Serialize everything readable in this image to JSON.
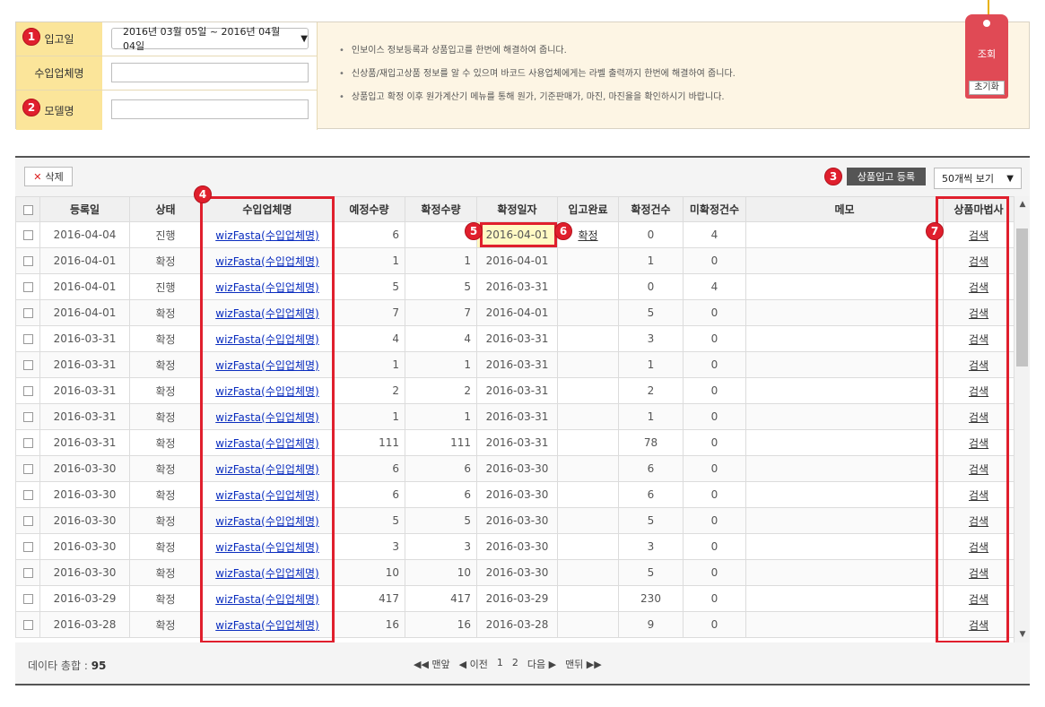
{
  "search": {
    "date_label": "입고일",
    "date_range": "2016년 03월 05일 ~ 2016년 04월 04일",
    "vendor_label": "수입업체명",
    "vendor_value": "",
    "model_label": "모델명",
    "model_value": "",
    "info": [
      "인보이스 정보등록과 상품입고를 한번에 해결하여 줍니다.",
      "신상품/재입고상품 정보를 알 수 있으며 바코드 사용업체에게는 라벨 출력까지 한번에 해결하여 줍니다.",
      "상품입고 확정 이후 원가계산기 메뉴를 통해 원가, 기준판매가, 마진, 마진율을 확인하시기 바랍니다."
    ],
    "search_button": "조회",
    "reset_button": "초기화"
  },
  "toolbar": {
    "delete_label": "삭제",
    "register_label": "상품입고 등록",
    "page_size": "50개씩 보기"
  },
  "badges": [
    "1",
    "2",
    "3",
    "4",
    "5",
    "6",
    "7"
  ],
  "table": {
    "headers": [
      "등록일",
      "상태",
      "수입업체명",
      "예정수량",
      "확정수량",
      "확정일자",
      "입고완료",
      "확정건수",
      "미확정건수",
      "메모",
      "상품마법사"
    ],
    "rows": [
      {
        "date": "2016-04-04",
        "status": "진행",
        "vendor": "wizFasta(수입업체명)",
        "planned": "6",
        "confirmed": "",
        "confirm_date": "2016-04-01",
        "done": "확정",
        "cnt_ok": "0",
        "cnt_pending": "4",
        "memo": "",
        "wizard": "검색"
      },
      {
        "date": "2016-04-01",
        "status": "확정",
        "vendor": "wizFasta(수입업체명)",
        "planned": "1",
        "confirmed": "1",
        "confirm_date": "2016-04-01",
        "done": "",
        "cnt_ok": "1",
        "cnt_pending": "0",
        "memo": "",
        "wizard": "검색"
      },
      {
        "date": "2016-04-01",
        "status": "진행",
        "vendor": "wizFasta(수입업체명)",
        "planned": "5",
        "confirmed": "5",
        "confirm_date": "2016-03-31",
        "done": "",
        "cnt_ok": "0",
        "cnt_pending": "4",
        "memo": "",
        "wizard": "검색"
      },
      {
        "date": "2016-04-01",
        "status": "확정",
        "vendor": "wizFasta(수입업체명)",
        "planned": "7",
        "confirmed": "7",
        "confirm_date": "2016-04-01",
        "done": "",
        "cnt_ok": "5",
        "cnt_pending": "0",
        "memo": "",
        "wizard": "검색"
      },
      {
        "date": "2016-03-31",
        "status": "확정",
        "vendor": "wizFasta(수입업체명)",
        "planned": "4",
        "confirmed": "4",
        "confirm_date": "2016-03-31",
        "done": "",
        "cnt_ok": "3",
        "cnt_pending": "0",
        "memo": "",
        "wizard": "검색"
      },
      {
        "date": "2016-03-31",
        "status": "확정",
        "vendor": "wizFasta(수입업체명)",
        "planned": "1",
        "confirmed": "1",
        "confirm_date": "2016-03-31",
        "done": "",
        "cnt_ok": "1",
        "cnt_pending": "0",
        "memo": "",
        "wizard": "검색"
      },
      {
        "date": "2016-03-31",
        "status": "확정",
        "vendor": "wizFasta(수입업체명)",
        "planned": "2",
        "confirmed": "2",
        "confirm_date": "2016-03-31",
        "done": "",
        "cnt_ok": "2",
        "cnt_pending": "0",
        "memo": "",
        "wizard": "검색"
      },
      {
        "date": "2016-03-31",
        "status": "확정",
        "vendor": "wizFasta(수입업체명)",
        "planned": "1",
        "confirmed": "1",
        "confirm_date": "2016-03-31",
        "done": "",
        "cnt_ok": "1",
        "cnt_pending": "0",
        "memo": "",
        "wizard": "검색"
      },
      {
        "date": "2016-03-31",
        "status": "확정",
        "vendor": "wizFasta(수입업체명)",
        "planned": "111",
        "confirmed": "111",
        "confirm_date": "2016-03-31",
        "done": "",
        "cnt_ok": "78",
        "cnt_pending": "0",
        "memo": "",
        "wizard": "검색"
      },
      {
        "date": "2016-03-30",
        "status": "확정",
        "vendor": "wizFasta(수입업체명)",
        "planned": "6",
        "confirmed": "6",
        "confirm_date": "2016-03-30",
        "done": "",
        "cnt_ok": "6",
        "cnt_pending": "0",
        "memo": "",
        "wizard": "검색"
      },
      {
        "date": "2016-03-30",
        "status": "확정",
        "vendor": "wizFasta(수입업체명)",
        "planned": "6",
        "confirmed": "6",
        "confirm_date": "2016-03-30",
        "done": "",
        "cnt_ok": "6",
        "cnt_pending": "0",
        "memo": "",
        "wizard": "검색"
      },
      {
        "date": "2016-03-30",
        "status": "확정",
        "vendor": "wizFasta(수입업체명)",
        "planned": "5",
        "confirmed": "5",
        "confirm_date": "2016-03-30",
        "done": "",
        "cnt_ok": "5",
        "cnt_pending": "0",
        "memo": "",
        "wizard": "검색"
      },
      {
        "date": "2016-03-30",
        "status": "확정",
        "vendor": "wizFasta(수입업체명)",
        "planned": "3",
        "confirmed": "3",
        "confirm_date": "2016-03-30",
        "done": "",
        "cnt_ok": "3",
        "cnt_pending": "0",
        "memo": "",
        "wizard": "검색"
      },
      {
        "date": "2016-03-30",
        "status": "확정",
        "vendor": "wizFasta(수입업체명)",
        "planned": "10",
        "confirmed": "10",
        "confirm_date": "2016-03-30",
        "done": "",
        "cnt_ok": "5",
        "cnt_pending": "0",
        "memo": "",
        "wizard": "검색"
      },
      {
        "date": "2016-03-29",
        "status": "확정",
        "vendor": "wizFasta(수입업체명)",
        "planned": "417",
        "confirmed": "417",
        "confirm_date": "2016-03-29",
        "done": "",
        "cnt_ok": "230",
        "cnt_pending": "0",
        "memo": "",
        "wizard": "검색"
      },
      {
        "date": "2016-03-28",
        "status": "확정",
        "vendor": "wizFasta(수입업체명)",
        "planned": "16",
        "confirmed": "16",
        "confirm_date": "2016-03-28",
        "done": "",
        "cnt_ok": "9",
        "cnt_pending": "0",
        "memo": "",
        "wizard": "검색"
      }
    ]
  },
  "footer": {
    "total_label": "데이타 총합 :",
    "total_value": "95",
    "pager": {
      "first": "◀◀ 맨앞",
      "prev": "◀ 이전",
      "pages": [
        "1",
        "2"
      ],
      "next": "다음 ▶",
      "last": "맨뒤 ▶▶"
    }
  },
  "colors": {
    "accent_red": "#e01f2d",
    "label_yellow": "#fbe59a",
    "panel_bg": "#fdf5e4",
    "link_blue": "#0a2dbf",
    "highlight": "#fff9c4"
  },
  "icons": {
    "delete": "close-icon",
    "dropdown": "caret-down-icon",
    "scroll_up": "arrow-up-icon",
    "scroll_down": "arrow-down-icon"
  }
}
